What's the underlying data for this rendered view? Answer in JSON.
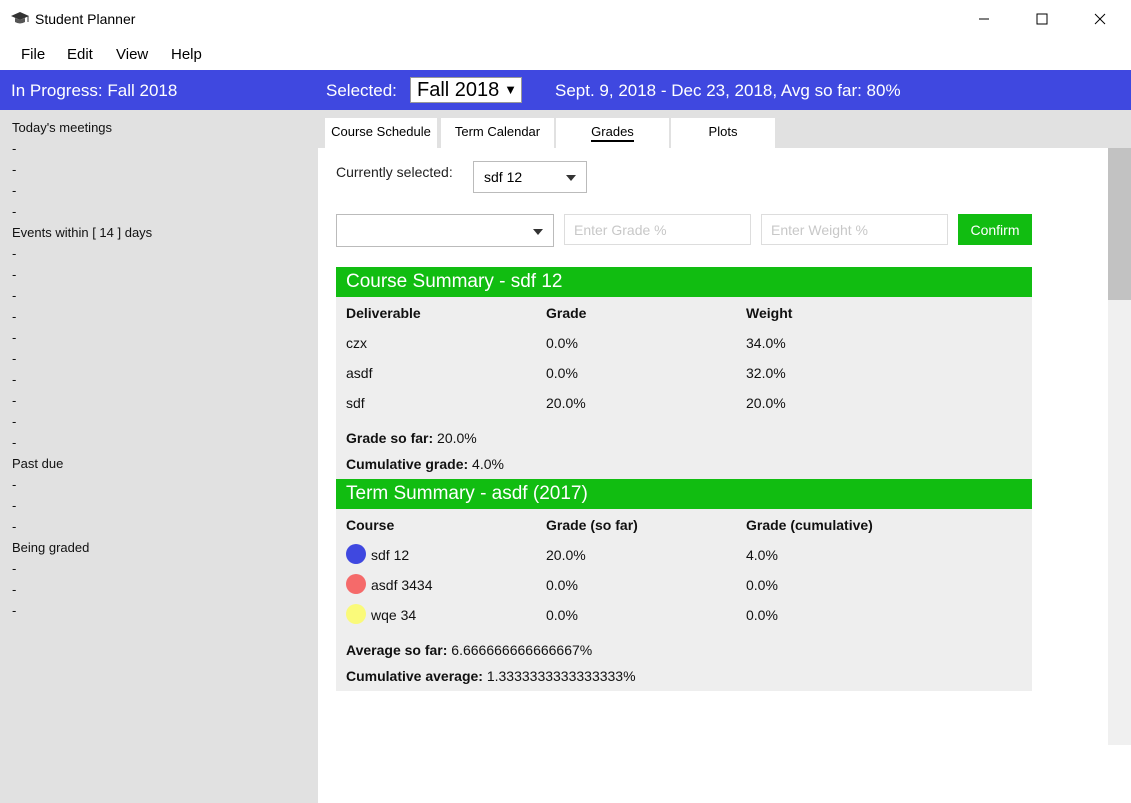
{
  "window": {
    "title": "Student Planner"
  },
  "menu": [
    "File",
    "Edit",
    "View",
    "Help"
  ],
  "header": {
    "in_progress": "In Progress: Fall 2018",
    "selected_label": "Selected:",
    "selected_term": "Fall 2018",
    "range": "Sept. 9, 2018 - Dec 23, 2018, Avg so far: 80%"
  },
  "sidebar": {
    "todays_meetings": "Today's meetings",
    "events_within": "Events within [ 14 ] days",
    "past_due": "Past due",
    "being_graded": "Being graded",
    "dash": "-"
  },
  "tabs": [
    "Course Schedule",
    "Term Calendar",
    "Grades",
    "Plots"
  ],
  "controls": {
    "currently_selected_label": "Currently selected:",
    "course_value": "sdf 12",
    "deliverable_value": "",
    "grade_placeholder": "Enter Grade %",
    "weight_placeholder": "Enter Weight %",
    "confirm_label": "Confirm"
  },
  "course_summary": {
    "title": "Course Summary - sdf 12",
    "headers": [
      "Deliverable",
      "Grade",
      "Weight"
    ],
    "rows": [
      [
        "czx",
        "0.0%",
        "34.0%"
      ],
      [
        "asdf",
        "0.0%",
        "32.0%"
      ],
      [
        "sdf",
        "20.0%",
        "20.0%"
      ]
    ],
    "grade_so_far_label": "Grade so far:",
    "grade_so_far_value": " 20.0%",
    "cumulative_label": "Cumulative grade:",
    "cumulative_value": " 4.0%"
  },
  "term_summary": {
    "title": "Term Summary - asdf (2017)",
    "headers": [
      "Course",
      "Grade (so far)",
      "Grade (cumulative)"
    ],
    "rows": [
      {
        "course": "sdf 12",
        "so_far": "20.0%",
        "cumulative": "4.0%",
        "color": "#3f48e0"
      },
      {
        "course": "asdf 3434",
        "so_far": "0.0%",
        "cumulative": "0.0%",
        "color": "#f56a6a"
      },
      {
        "course": "wqe 34",
        "so_far": "0.0%",
        "cumulative": "0.0%",
        "color": "#fafa7a"
      }
    ],
    "average_label": "Average so far:",
    "average_value": " 6.666666666666667%",
    "cumulative_avg_label": "Cumulative average:",
    "cumulative_avg_value": " 1.3333333333333333%"
  },
  "colors": {
    "header_blue": "#3f48e0",
    "accent_green": "#11bd11",
    "sidebar_gray": "#e1e1e1"
  }
}
